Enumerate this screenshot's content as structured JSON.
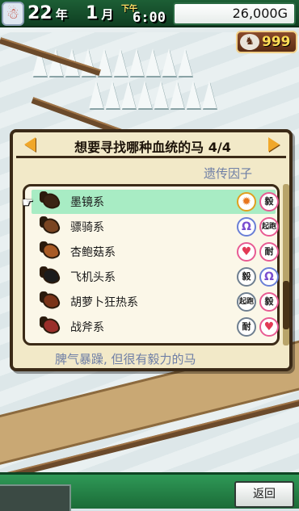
{
  "status": {
    "year": "22",
    "year_unit": "年",
    "month": "1",
    "month_unit": "月",
    "ampm": "下午",
    "time": "6:00",
    "money": "26,000G"
  },
  "badge": {
    "icon": "horse-medal-icon",
    "value": "999"
  },
  "dialog": {
    "title": "想要寻找哪种血统的马 4/4",
    "genes_header": "遗传因子",
    "description": "脾气暴躁, 但很有毅力的马",
    "rows": [
      {
        "label": "墨镜系",
        "horse_color": "#3a2414",
        "genes": [
          {
            "text": "",
            "icon": "star",
            "color": "gold"
          },
          {
            "text": "毅",
            "color": "pink"
          }
        ]
      },
      {
        "label": "骠骑系",
        "horse_color": "#7a4522",
        "genes": [
          {
            "text": "",
            "icon": "horseshoe",
            "color": "blue"
          },
          {
            "text": "起跑",
            "color": "pink"
          }
        ]
      },
      {
        "label": "杏鲍菇系",
        "horse_color": "#a85a24",
        "genes": [
          {
            "text": "",
            "icon": "heart",
            "color": "pink"
          },
          {
            "text": "耐",
            "color": "pink"
          }
        ]
      },
      {
        "label": "飞机头系",
        "horse_color": "#1c1c1c",
        "genes": [
          {
            "text": "毅",
            "color": "grey"
          },
          {
            "text": "",
            "icon": "horseshoe",
            "color": "blue"
          }
        ]
      },
      {
        "label": "胡萝卜狂热系",
        "horse_color": "#7a3418",
        "genes": [
          {
            "text": "起跑",
            "color": "grey"
          },
          {
            "text": "毅",
            "color": "pink"
          }
        ]
      },
      {
        "label": "战斧系",
        "horse_color": "#9a2f2a",
        "genes": [
          {
            "text": "耐",
            "color": "grey"
          },
          {
            "text": "",
            "icon": "heart",
            "color": "pink"
          }
        ]
      }
    ]
  },
  "bottom": {
    "back_label": "返回"
  }
}
